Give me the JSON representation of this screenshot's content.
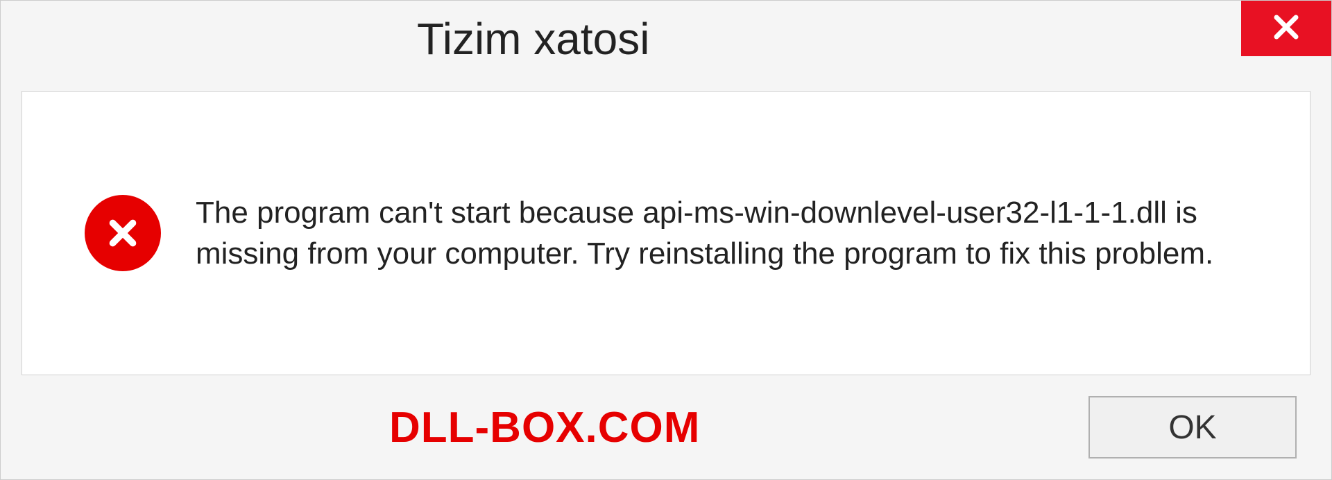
{
  "dialog": {
    "title": "Tizim xatosi",
    "message": "The program can't start because api-ms-win-downlevel-user32-l1-1-1.dll is missing from your computer. Try reinstalling the program to fix this problem.",
    "ok_label": "OK"
  },
  "watermark": "DLL-BOX.COM"
}
